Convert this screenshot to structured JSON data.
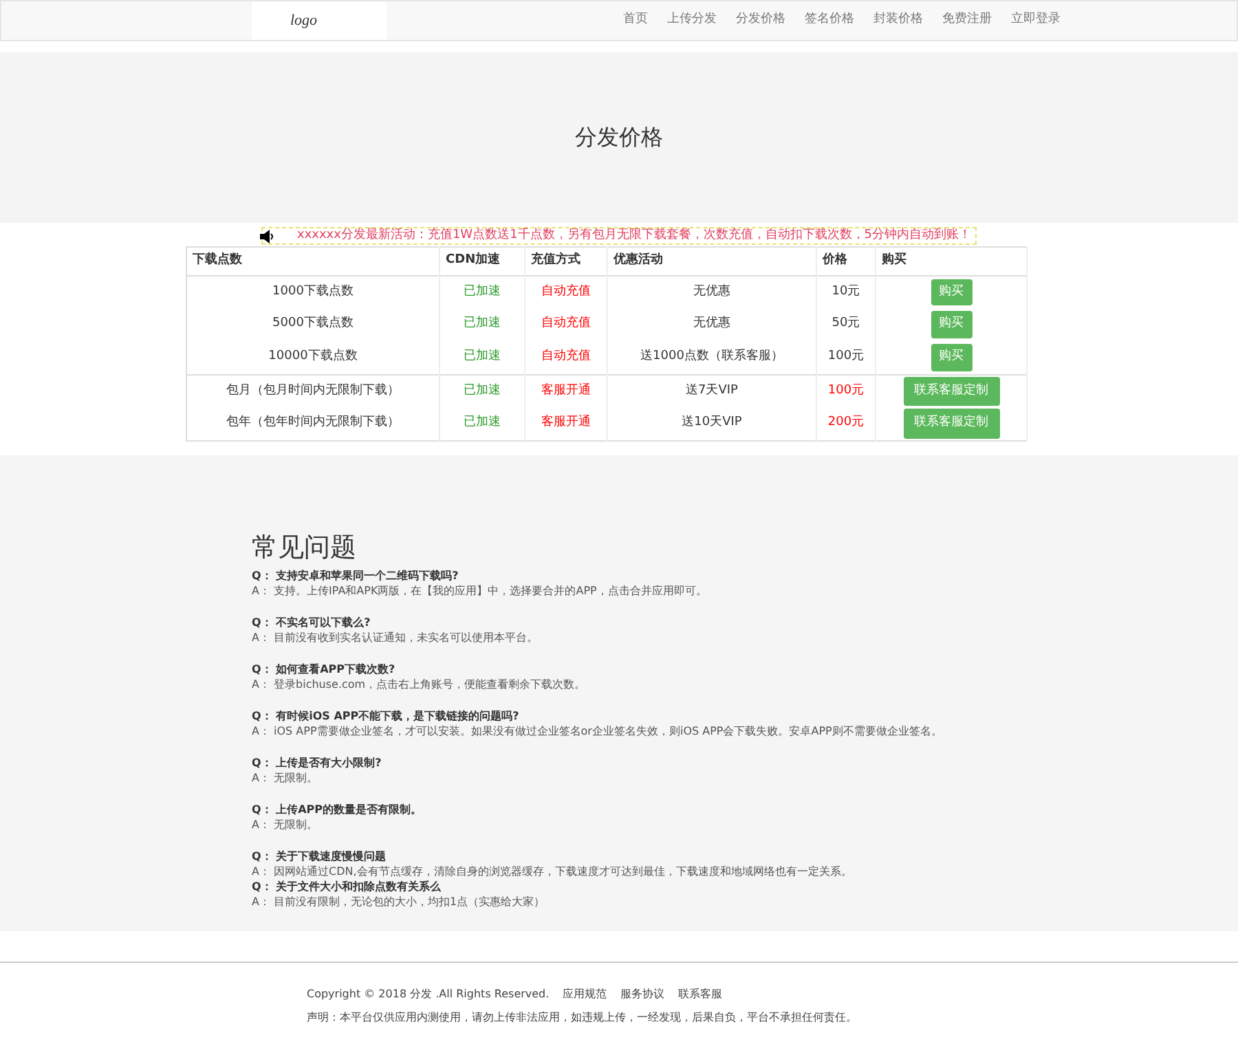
{
  "logo": "logo",
  "nav": [
    {
      "label": "首页"
    },
    {
      "label": "上传分发"
    },
    {
      "label": "分发价格"
    },
    {
      "label": "签名价格"
    },
    {
      "label": "封装价格"
    },
    {
      "label": "免费注册"
    },
    {
      "label": "立即登录"
    }
  ],
  "hero": {
    "title": "分发价格"
  },
  "notice": "xxxxxx分发最新活动：充值1W点数送1千点数，另有包月无限下载套餐，次数充值，自动扣下载次数，5分钟内自动到账！",
  "table": {
    "columns": [
      "下载点数",
      "CDN加速",
      "充值方式",
      "优惠活动",
      "价格",
      "购买"
    ],
    "rows": [
      {
        "kind": "points",
        "points": "1000下载点数",
        "cdn": "已加速",
        "pay": "自动充值",
        "promo": "无优惠",
        "price": "10元",
        "button": "购买"
      },
      {
        "kind": "points",
        "points": "5000下载点数",
        "cdn": "已加速",
        "pay": "自动充值",
        "promo": "无优惠",
        "price": "50元",
        "button": "购买"
      },
      {
        "kind": "points",
        "points": "10000下载点数",
        "cdn": "已加速",
        "pay": "自动充值",
        "promo": "送1000点数（联系客服）",
        "price": "100元",
        "button": "购买"
      },
      {
        "kind": "plan",
        "points": "包月（包月时间内无限制下载）",
        "cdn": "已加速",
        "pay": "客服开通",
        "promo": "送7天VIP",
        "price": "100元",
        "button": "联系客服定制"
      },
      {
        "kind": "plan",
        "points": "包年（包年时间内无限制下载）",
        "cdn": "已加速",
        "pay": "客服开通",
        "promo": "送10天VIP",
        "price": "200元",
        "button": "联系客服定制"
      }
    ]
  },
  "faq": {
    "title": "常见问题",
    "items": [
      {
        "q": "Q：",
        "question": "支持安卓和苹果同一个二维码下载吗?",
        "a": "A：",
        "answer": "支持。上传IPA和APK两版，在【我的应用】中，选择要合并的APP，点击合并应用即可。",
        "gap": true
      },
      {
        "q": "Q：",
        "question": "不实名可以下载么?",
        "a": "A：",
        "answer": "目前没有收到实名认证通知，未实名可以使用本平台。",
        "gap": true
      },
      {
        "q": "Q：",
        "question": "如何查看APP下载次数?",
        "a": "A：",
        "answer": "登录bichuse.com，点击右上角账号，便能查看剩余下载次数。",
        "gap": true
      },
      {
        "q": "Q：",
        "question": "有时候iOS APP不能下载，是下载链接的问题吗?",
        "a": "A：",
        "answer": "iOS APP需要做企业签名，才可以安装。如果没有做过企业签名or企业签名失效，则iOS APP会下载失败。安卓APP则不需要做企业签名。",
        "gap": true
      },
      {
        "q": "Q：",
        "question": "上传是否有大小限制?",
        "a": "A：",
        "answer": "无限制。",
        "gap": true
      },
      {
        "q": "Q：",
        "question": "上传APP的数量是否有限制。",
        "a": "A：",
        "answer": "无限制。",
        "gap": true
      },
      {
        "q": "Q：",
        "question": "关于下载速度慢慢问题",
        "a": "A：",
        "answer": "因网站通过CDN,会有节点缓存，清除自身的浏览器缓存，下载速度才可达到最佳，下载速度和地域网络也有一定关系。",
        "gap": false
      },
      {
        "q": "Q：",
        "question": "关于文件大小和扣除点数有关系么",
        "a": "A：",
        "answer": "目前没有限制，无论包的大小，均扣1点（实惠给大家）",
        "gap": false
      }
    ]
  },
  "footer": {
    "copyright": "Copyright © 2018 分发 .All Rights Reserved.",
    "links": [
      "应用规范",
      "服务协议",
      "联系客服"
    ],
    "disclaimer": "声明：本平台仅供应用内测使用，请勿上传非法应用，如违规上传，一经发现，后果自负，平台不承担任何责任。"
  }
}
